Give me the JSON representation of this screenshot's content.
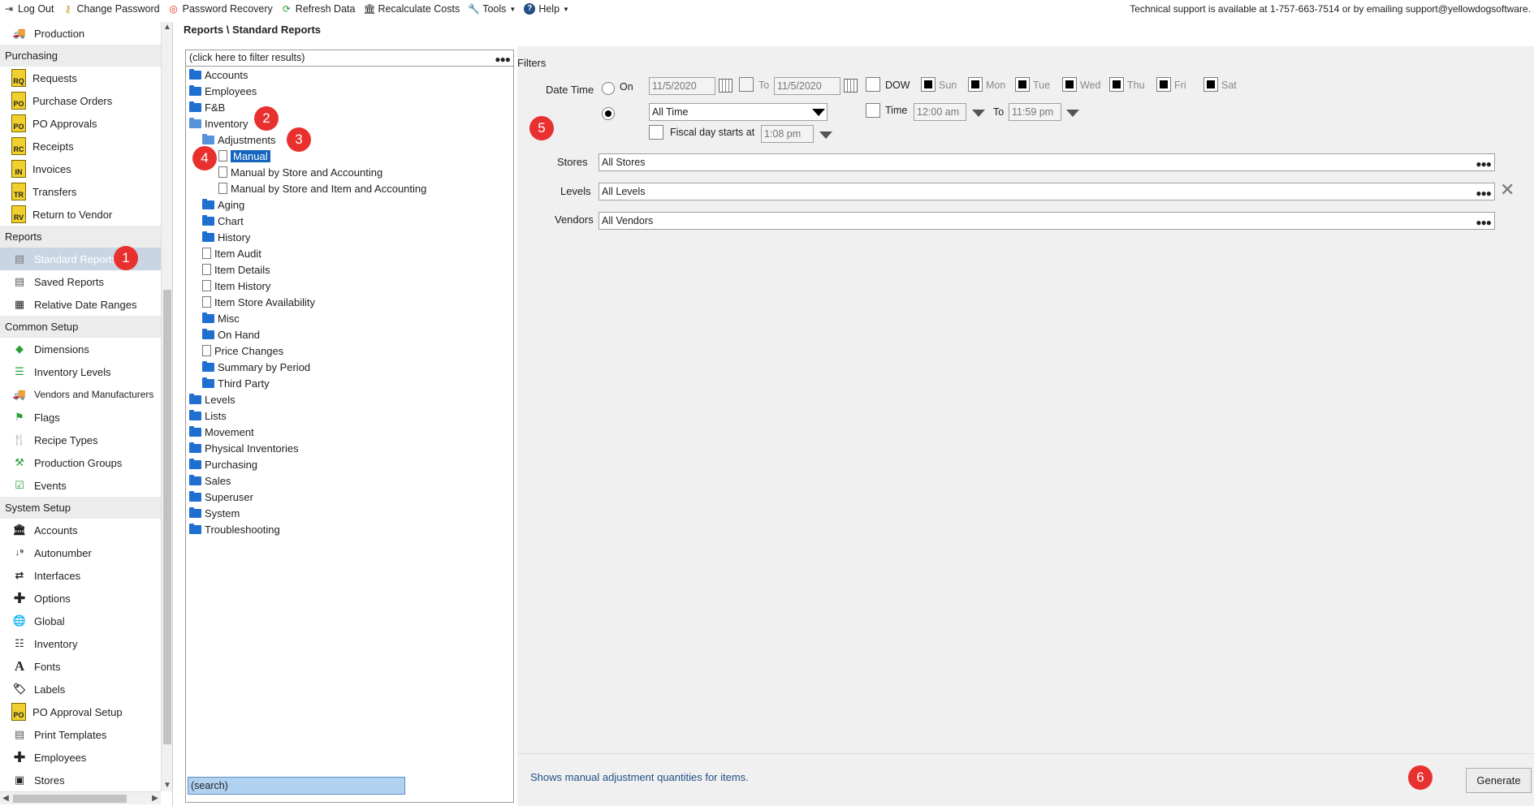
{
  "toolbar": {
    "items": [
      {
        "label": "Log Out",
        "icon": "logout-icon"
      },
      {
        "label": "Change Password",
        "icon": "key-icon"
      },
      {
        "label": "Password Recovery",
        "icon": "lifebuoy-icon"
      },
      {
        "label": "Refresh Data",
        "icon": "refresh-icon"
      },
      {
        "label": "Recalculate Costs",
        "icon": "bank-icon"
      },
      {
        "label": "Tools",
        "icon": "wrench-icon"
      },
      {
        "label": "Help",
        "icon": "help-icon"
      }
    ],
    "support_text": "Technical support is available at 1-757-663-7514 or by emailing support@yellowdogsoftware."
  },
  "sidebar": {
    "top_item": "Production",
    "groups": [
      {
        "title": "Purchasing",
        "items": [
          {
            "label": "Requests",
            "icon_text": "RQ"
          },
          {
            "label": "Purchase Orders",
            "icon_text": "PO"
          },
          {
            "label": "PO Approvals",
            "icon_text": "PO"
          },
          {
            "label": "Receipts",
            "icon_text": "RC"
          },
          {
            "label": "Invoices",
            "icon_text": "IN"
          },
          {
            "label": "Transfers",
            "icon_text": "TR"
          },
          {
            "label": "Return to Vendor",
            "icon_text": "RV"
          }
        ]
      },
      {
        "title": "Reports",
        "items": [
          {
            "label": "Standard Reports"
          },
          {
            "label": "Saved Reports"
          },
          {
            "label": "Relative Date Ranges"
          }
        ]
      },
      {
        "title": "Common Setup",
        "items": [
          {
            "label": "Dimensions"
          },
          {
            "label": "Inventory Levels"
          },
          {
            "label": "Vendors and Manufacturers"
          },
          {
            "label": "Flags"
          },
          {
            "label": "Recipe Types"
          },
          {
            "label": "Production Groups"
          },
          {
            "label": "Events"
          }
        ]
      },
      {
        "title": "System Setup",
        "items": [
          {
            "label": "Accounts"
          },
          {
            "label": "Autonumber"
          },
          {
            "label": "Interfaces"
          },
          {
            "label": "Options"
          },
          {
            "label": "Global"
          },
          {
            "label": "Inventory"
          },
          {
            "label": "Fonts"
          },
          {
            "label": "Labels"
          },
          {
            "label": "PO Approval Setup",
            "icon_text": "PO"
          },
          {
            "label": "Print Templates"
          },
          {
            "label": "Employees"
          },
          {
            "label": "Stores"
          }
        ]
      }
    ]
  },
  "breadcrumb": "Reports \\ Standard Reports",
  "tree": {
    "filter_placeholder": "(click here to filter results)",
    "search_text": "(search)",
    "nodes": [
      {
        "label": "Accounts",
        "type": "folder",
        "level": 0
      },
      {
        "label": "Employees",
        "type": "folder",
        "level": 0
      },
      {
        "label": "F&B",
        "type": "folder",
        "level": 0
      },
      {
        "label": "Inventory",
        "type": "folder-open",
        "level": 0
      },
      {
        "label": "Adjustments",
        "type": "folder-open",
        "level": 1
      },
      {
        "label": "Manual",
        "type": "file",
        "level": 2,
        "selected": true
      },
      {
        "label": "Manual by Store and Accounting",
        "type": "file",
        "level": 2
      },
      {
        "label": "Manual by Store and Item and Accounting",
        "type": "file",
        "level": 2
      },
      {
        "label": "Aging",
        "type": "folder",
        "level": 1
      },
      {
        "label": "Chart",
        "type": "folder",
        "level": 1
      },
      {
        "label": "History",
        "type": "folder",
        "level": 1
      },
      {
        "label": "Item Audit",
        "type": "file",
        "level": 1
      },
      {
        "label": "Item Details",
        "type": "file",
        "level": 1
      },
      {
        "label": "Item History",
        "type": "file",
        "level": 1
      },
      {
        "label": "Item Store Availability",
        "type": "file",
        "level": 1
      },
      {
        "label": "Misc",
        "type": "folder",
        "level": 1
      },
      {
        "label": "On Hand",
        "type": "folder",
        "level": 1
      },
      {
        "label": "Price Changes",
        "type": "file",
        "level": 1
      },
      {
        "label": "Summary by Period",
        "type": "folder",
        "level": 1
      },
      {
        "label": "Third Party",
        "type": "folder",
        "level": 1
      },
      {
        "label": "Levels",
        "type": "folder",
        "level": 0
      },
      {
        "label": "Lists",
        "type": "folder",
        "level": 0
      },
      {
        "label": "Movement",
        "type": "folder",
        "level": 0
      },
      {
        "label": "Physical Inventories",
        "type": "folder",
        "level": 0
      },
      {
        "label": "Purchasing",
        "type": "folder",
        "level": 0
      },
      {
        "label": "Sales",
        "type": "folder",
        "level": 0
      },
      {
        "label": "Superuser",
        "type": "folder",
        "level": 0
      },
      {
        "label": "System",
        "type": "folder",
        "level": 0
      },
      {
        "label": "Troubleshooting",
        "type": "folder",
        "level": 0
      }
    ]
  },
  "filters": {
    "title": "Filters",
    "date_time_label": "Date Time",
    "on_label": "On",
    "on_date": "11/5/2020",
    "to_label": "To",
    "to_date": "11/5/2020",
    "dow_label": "DOW",
    "days": [
      "Sun",
      "Mon",
      "Tue",
      "Wed",
      "Thu",
      "Fri",
      "Sat"
    ],
    "range_value": "All Time",
    "time_label": "Time",
    "time_from": "12:00 am",
    "time_to_label": "To",
    "time_to": "11:59 pm",
    "fiscal_label": "Fiscal day starts at",
    "fiscal_time": "1:08 pm",
    "stores_label": "Stores",
    "stores_value": "All Stores",
    "levels_label": "Levels",
    "levels_value": "All Levels",
    "vendors_label": "Vendors",
    "vendors_value": "All Vendors"
  },
  "footer": {
    "description": "Shows manual adjustment quantities for items.",
    "generate_label": "Generate"
  },
  "badges": [
    "1",
    "2",
    "3",
    "4",
    "5",
    "6"
  ],
  "colors": {
    "badge": "#e8312f",
    "selection": "#1565c0",
    "folder": "#1f6fd0"
  }
}
